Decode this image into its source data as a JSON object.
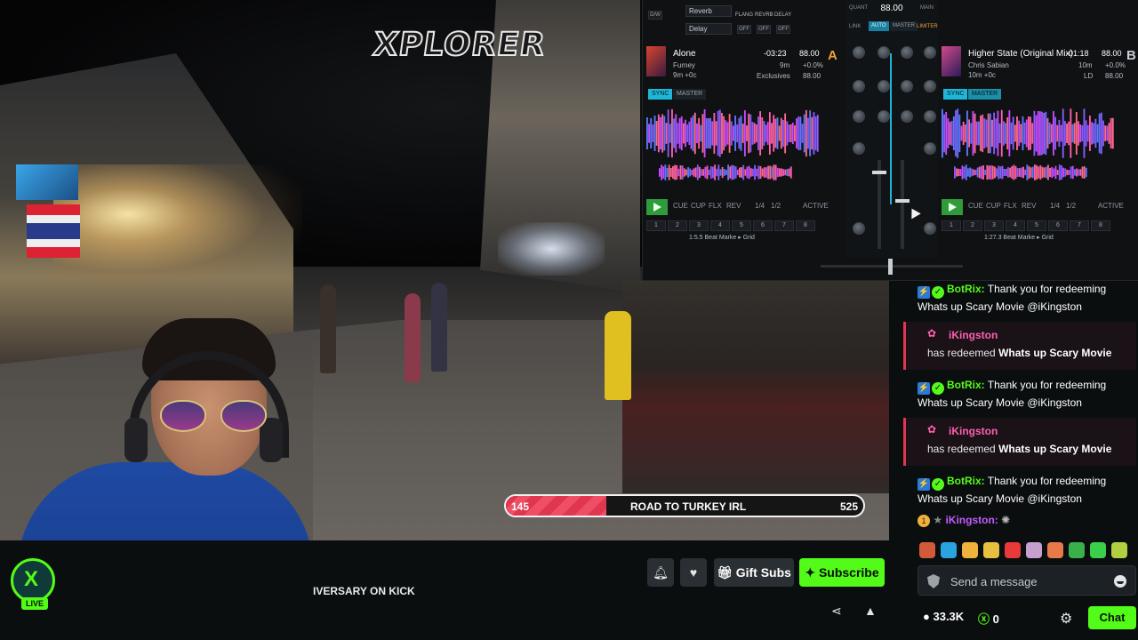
{
  "video": {
    "watermark": "XPLORER",
    "goal": {
      "start": "145",
      "title": "ROAD TO TURKEY IRL",
      "end": "525",
      "progress": 0.28
    }
  },
  "dj": {
    "fx_a": [
      "Reverb",
      "Delay"
    ],
    "fx_labels": [
      "FLANG",
      "REVRB",
      "DELAY"
    ],
    "offs": [
      "OFF",
      "OFF",
      "OFF"
    ],
    "mixer_bpm": "88.00",
    "mixer_buttons": [
      "AUTO",
      "MASTER"
    ],
    "mixer_small": [
      "QUANT",
      "MAIN",
      "LINK",
      "LIMITER"
    ],
    "deck_a": {
      "letter": "A",
      "title": "Alone",
      "artist": "Furney",
      "key": "9m +0c",
      "remaining": "-03:23",
      "bpm": "88.00",
      "pitch": "+0.0%",
      "pitch2": "9m",
      "label": "Exclusives",
      "bpm2": "88.00",
      "sync": "SYNC",
      "master": "MASTER",
      "transport": [
        "CUE",
        "CUP",
        "FLX",
        "REV",
        "1/4",
        "1/2",
        "ACTIVE"
      ],
      "cues": [
        "1",
        "2",
        "3",
        "4",
        "5",
        "6",
        "7",
        "8"
      ],
      "beat": "1:5.5  Beat Marke ▸ Grid"
    },
    "deck_b": {
      "letter": "B",
      "title": "Higher State (Original Mix)",
      "artist": "Chris Sabian",
      "key": "10m +0c",
      "remaining": "-01:18",
      "bpm": "88.00",
      "pitch": "+0.0%",
      "pitch2": "10m",
      "label": "LD",
      "bpm2": "88.00",
      "sync": "SYNC",
      "master": "MASTER",
      "transport": [
        "CUE",
        "CUP",
        "FLX",
        "REV",
        "1/4",
        "1/2",
        "ACTIVE"
      ],
      "cues": [
        "1",
        "2",
        "3",
        "4",
        "5",
        "6",
        "7",
        "8"
      ],
      "beat": "1:27.3  Beat Marke ▸ Grid"
    }
  },
  "chat": {
    "messages": [
      {
        "type": "bot",
        "user": "BotRix:",
        "text1": "Thank you for redeeming",
        "text2": "Whats up Scary Movie @iKingston"
      },
      {
        "type": "redeem",
        "user": "iKingston",
        "prefix": "has redeemed ",
        "reward": "Whats up Scary Movie"
      },
      {
        "type": "bot",
        "user": "BotRix:",
        "text1": "Thank you for redeeming",
        "text2": "Whats up Scary Movie @iKingston"
      },
      {
        "type": "redeem",
        "user": "iKingston",
        "prefix": "has redeemed ",
        "reward": "Whats up Scary Movie"
      },
      {
        "type": "bot",
        "user": "BotRix:",
        "text1": "Thank you for redeeming",
        "text2": "Whats up Scary Movie @iKingston"
      }
    ],
    "last_user": "iKingston:",
    "placeholder": "Send a message",
    "viewers": "33.3K",
    "points": "0",
    "chat_button": "Chat",
    "emote_colors": [
      "#d25a3a",
      "#2aa4e0",
      "#f0b23a",
      "#e8c040",
      "#e83a3a",
      "#c8a0d0",
      "#e87a4a",
      "#3ab04a",
      "#3ad04a",
      "#b0d040"
    ]
  },
  "bar": {
    "live": "LIVE",
    "title": "IVERSARY ON KICK",
    "gift_subs": "Gift Subs",
    "subscribe": "Subscribe"
  }
}
